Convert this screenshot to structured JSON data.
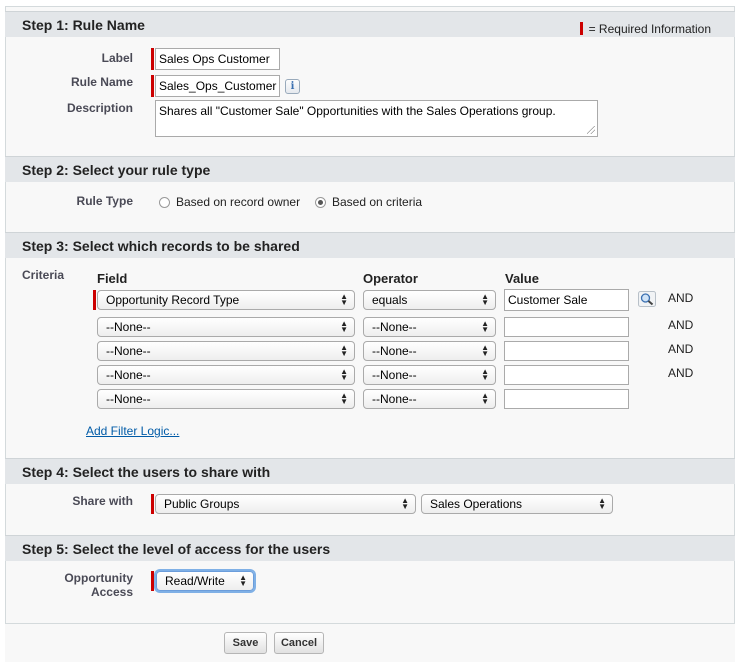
{
  "legend": {
    "required": "= Required Information"
  },
  "step1": {
    "title": "Step 1: Rule Name",
    "label_label": "Label",
    "label_value": "Sales Ops Customer",
    "rulename_label": "Rule Name",
    "rulename_value": "Sales_Ops_Customer",
    "description_label": "Description",
    "description_value": "Shares all \"Customer Sale\" Opportunities with the Sales Operations group."
  },
  "step2": {
    "title": "Step 2: Select your rule type",
    "ruletype_label": "Rule Type",
    "options": [
      "Based on record owner",
      "Based on criteria"
    ],
    "selected": "Based on criteria"
  },
  "step3": {
    "title": "Step 3: Select which records to be shared",
    "criteria_label": "Criteria",
    "columns": [
      "Field",
      "Operator",
      "Value"
    ],
    "rows": [
      {
        "field": "Opportunity Record Type",
        "operator": "equals",
        "value": "Customer Sale",
        "conj": "AND"
      },
      {
        "field": "--None--",
        "operator": "--None--",
        "value": "",
        "conj": "AND"
      },
      {
        "field": "--None--",
        "operator": "--None--",
        "value": "",
        "conj": "AND"
      },
      {
        "field": "--None--",
        "operator": "--None--",
        "value": "",
        "conj": "AND"
      },
      {
        "field": "--None--",
        "operator": "--None--",
        "value": "",
        "conj": ""
      }
    ],
    "filter_logic_link": "Add Filter Logic..."
  },
  "step4": {
    "title": "Step 4: Select the users to share with",
    "share_label": "Share with",
    "type_value": "Public Groups",
    "group_value": "Sales Operations"
  },
  "step5": {
    "title": "Step 5: Select the level of access for the users",
    "access_label_1": "Opportunity",
    "access_label_2": "Access",
    "access_value": "Read/Write"
  },
  "buttons": {
    "save": "Save",
    "cancel": "Cancel"
  },
  "icons": {
    "info": "info-icon",
    "lookup": "lookup-magnifier-icon",
    "select_arrow": "updown-arrow-icon"
  },
  "colors": {
    "required": "#cc0000",
    "link": "#015ba7",
    "section_bg": "#e3e6e9"
  }
}
